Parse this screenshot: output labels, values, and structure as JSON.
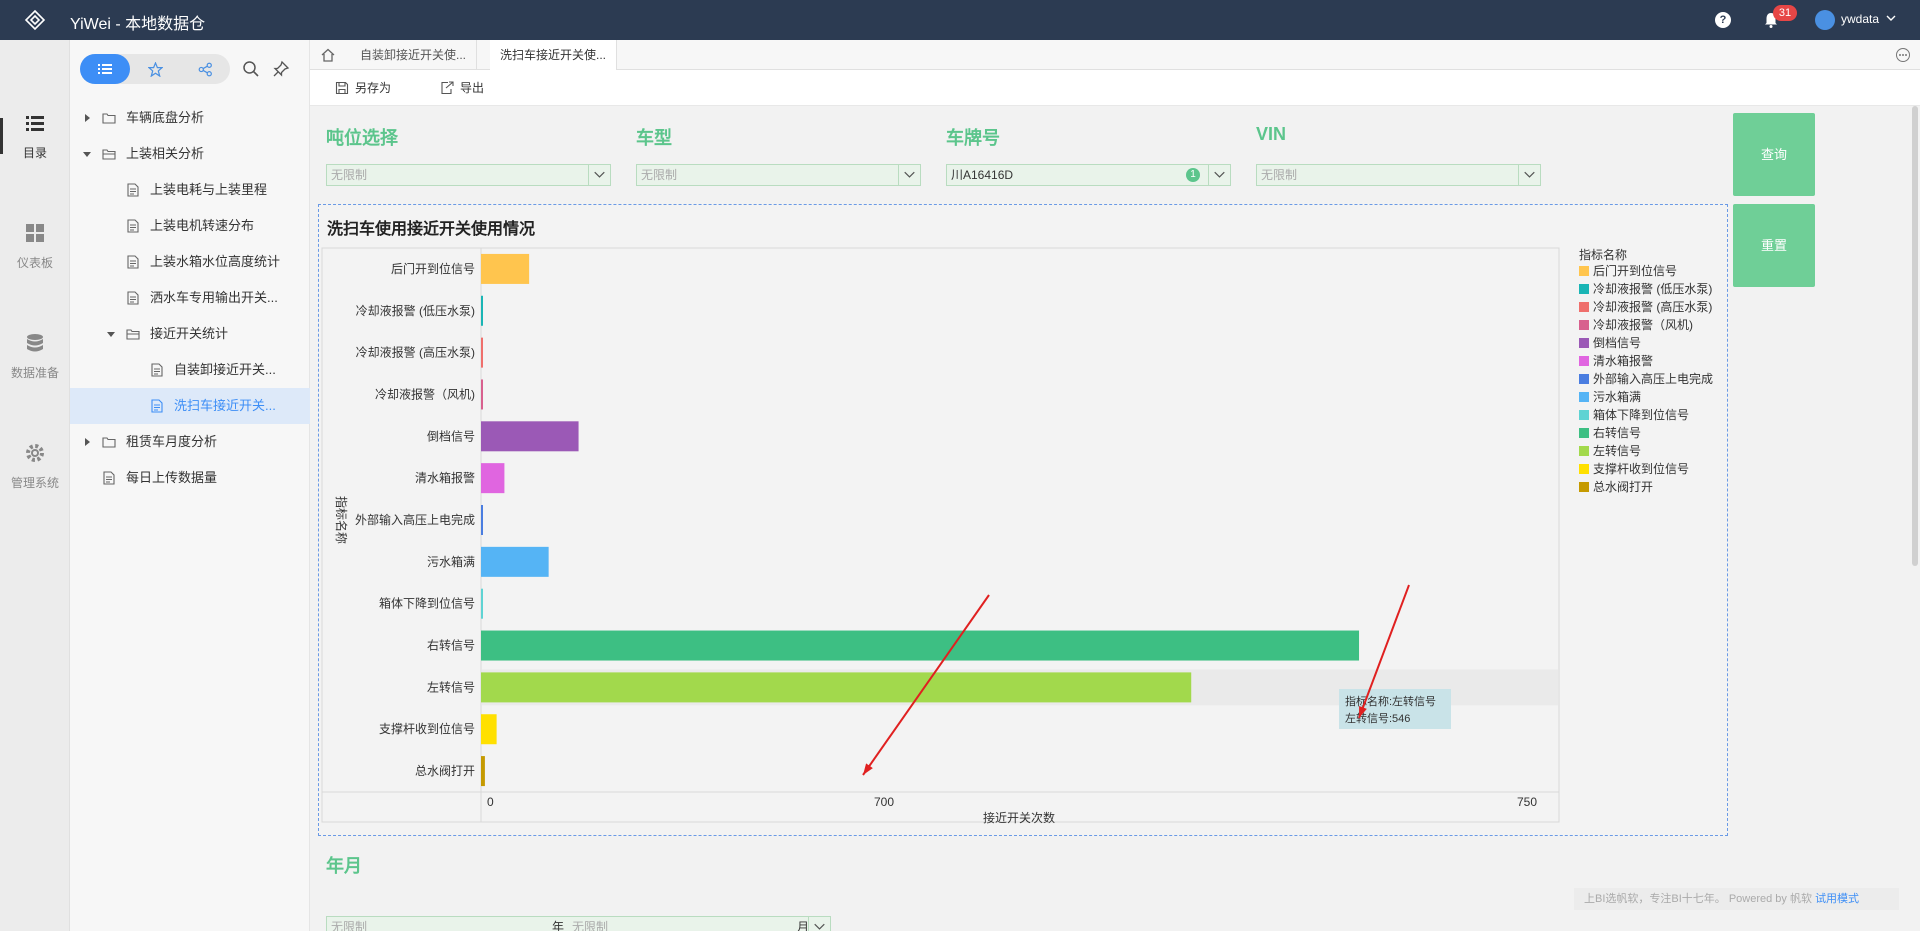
{
  "app": {
    "title": "YiWei - 本地数据仓",
    "notifications": "31",
    "user": "ywdata",
    "help": "?"
  },
  "rail": [
    {
      "label": "目录",
      "icon": "list-icon"
    },
    {
      "label": "仪表板",
      "icon": "dashboard-icon"
    },
    {
      "label": "数据准备",
      "icon": "database-icon"
    },
    {
      "label": "管理系统",
      "icon": "gear-icon"
    }
  ],
  "tree": {
    "nodes": [
      {
        "label": "车辆底盘分析",
        "level": 0,
        "type": "folder",
        "state": "collapsed"
      },
      {
        "label": "上装相关分析",
        "level": 0,
        "type": "folder",
        "state": "expanded"
      },
      {
        "label": "上装电耗与上装里程",
        "level": 1,
        "type": "file"
      },
      {
        "label": "上装电机转速分布",
        "level": 1,
        "type": "file"
      },
      {
        "label": "上装水箱水位高度统计",
        "level": 1,
        "type": "file"
      },
      {
        "label": "洒水车专用输出开关...",
        "level": 1,
        "type": "file"
      },
      {
        "label": "接近开关统计",
        "level": 1,
        "type": "folder",
        "state": "expanded"
      },
      {
        "label": "自装卸接近开关...",
        "level": 2,
        "type": "file"
      },
      {
        "label": "洗扫车接近开关...",
        "level": 2,
        "type": "file",
        "selected": true
      },
      {
        "label": "租赁车月度分析",
        "level": 0,
        "type": "folder",
        "state": "collapsed"
      },
      {
        "label": "每日上传数据量",
        "level": 0,
        "type": "file"
      }
    ]
  },
  "tabs": [
    {
      "label": "自装卸接近开关使...",
      "active": false
    },
    {
      "label": "洗扫车接近开关使...",
      "active": true
    }
  ],
  "toolbar": {
    "save_as": "另存为",
    "export": "导出"
  },
  "filters": {
    "tonnage": {
      "label": "吨位选择",
      "value": "无限制"
    },
    "model": {
      "label": "车型",
      "value": "无限制"
    },
    "plate": {
      "label": "车牌号",
      "value": "川A16416D",
      "count": "1"
    },
    "vin": {
      "label": "VIN",
      "value": "无限制"
    },
    "query_label": "查询",
    "reset_label": "重置"
  },
  "yearmonth": {
    "label": "年月",
    "year_value": "无限制",
    "year_unit": "年",
    "month_value": "无限制",
    "month_unit": "月"
  },
  "chart_data": {
    "type": "bar",
    "orientation": "horizontal",
    "title": "洗扫车使用接近开关使用情况",
    "xlabel": "接近开关次数",
    "ylabel": "指标名称",
    "xticks": [
      "0",
      "700",
      "750"
    ],
    "legend_title": "指标名称",
    "legend_position": "right",
    "categories": [
      "后门开到位信号",
      "冷却液报警 (低压水泵)",
      "冷却液报警 (高压水泵)",
      "冷却液报警（风机)",
      "倒档信号",
      "清水箱报警",
      "外部输入高压上电完成",
      "污水箱满",
      "箱体下降到位信号",
      "右转信号",
      "左转信号",
      "支撑杆收到位信号",
      "总水阀打开"
    ],
    "values": [
      37,
      1,
      1,
      1,
      75,
      18,
      1,
      52,
      1,
      675,
      546,
      12,
      3
    ],
    "colors": [
      "#ffc54e",
      "#1ab5b5",
      "#ef6f6c",
      "#d8608e",
      "#9b59b6",
      "#e065e0",
      "#4a7de0",
      "#55b4f5",
      "#5fd3d3",
      "#3dbf83",
      "#a2d94c",
      "#ffe000",
      "#c59a00"
    ],
    "legend_labels": [
      "后门开到位信号",
      "冷却液报警 (低压水泵)",
      "冷却液报警 (高压水泵)",
      "冷却液报警（风机)",
      "倒档信号",
      "清水箱报警",
      "外部输入高压上电完成",
      "污水箱满",
      "箱体下降到位信号",
      "右转信号",
      "左转信号",
      "支撑杆收到位信号",
      "总水阀打开"
    ],
    "tooltip": {
      "line1": "指标名称:左转信号",
      "line2": "左转信号:546"
    }
  },
  "footer": {
    "watermark": "上BI选帆软，专注BI十七年。 Powered by 帆软",
    "trial": "试用模式"
  }
}
